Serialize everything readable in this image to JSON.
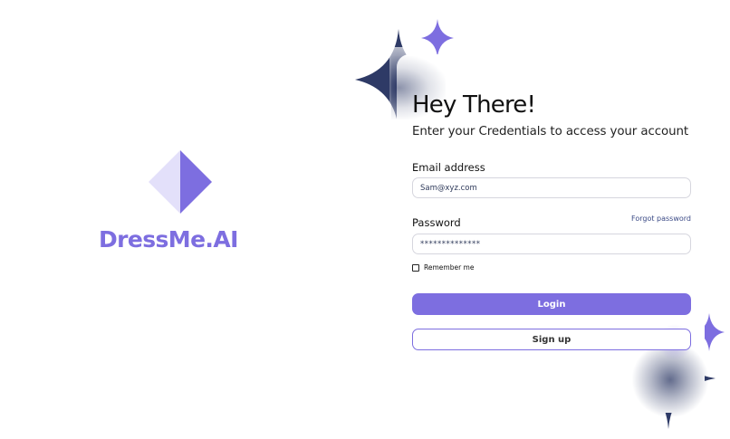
{
  "brand": {
    "name": "DressMe.AI",
    "colors": {
      "primary": "#7d6ee0",
      "logo_light": "#e3e0fa",
      "sparkle_dark": "#2e3a66",
      "sparkle_light": "#7d6ee0"
    }
  },
  "login": {
    "heading": "Hey There!",
    "subheading": "Enter your Credentials to access your account",
    "email": {
      "label": "Email address",
      "value": "Sam@xyz.com"
    },
    "password": {
      "label": "Password",
      "value": "**************",
      "forgot_label": "Forgot password"
    },
    "remember_label": "Remember me",
    "remember_checked": false,
    "login_label": "Login",
    "signup_label": "Sign up"
  },
  "icons": {
    "logo": "diamond-logo-icon",
    "decor": "sparkle-icon"
  }
}
